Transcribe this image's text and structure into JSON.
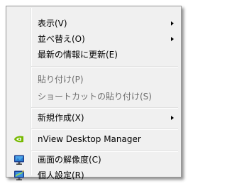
{
  "context_menu": {
    "items": [
      {
        "label": "表示(V)",
        "has_submenu": true,
        "enabled": true
      },
      {
        "label": "並べ替え(O)",
        "has_submenu": true,
        "enabled": true
      },
      {
        "label": "最新の情報に更新(E)",
        "has_submenu": false,
        "enabled": true
      },
      {
        "label": "貼り付け(P)",
        "has_submenu": false,
        "enabled": false
      },
      {
        "label": "ショートカットの貼り付け(S)",
        "has_submenu": false,
        "enabled": false
      },
      {
        "label": "新規作成(X)",
        "has_submenu": true,
        "enabled": true
      },
      {
        "label": "nView Desktop Manager",
        "has_submenu": false,
        "enabled": true,
        "icon": "nvidia-icon"
      },
      {
        "label": "画面の解像度(C)",
        "has_submenu": false,
        "enabled": true,
        "icon": "display-resolution-icon"
      },
      {
        "label": "個人設定(R)",
        "has_submenu": false,
        "enabled": true,
        "icon": "personalize-icon"
      }
    ]
  },
  "colors": {
    "menu_background": "#f0f0f0",
    "menu_border": "#979797",
    "disabled_text": "#6d6d6d",
    "nvidia_green": "#76b900"
  }
}
